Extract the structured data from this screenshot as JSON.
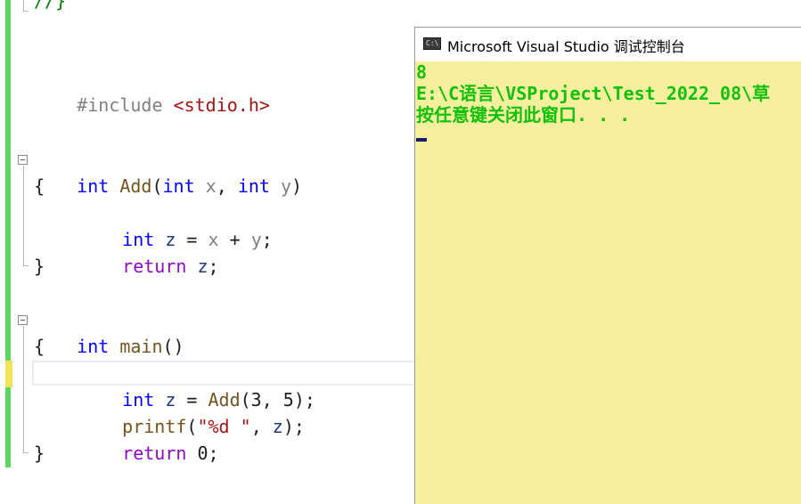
{
  "editor": {
    "top_fragment": "//}",
    "lines": {
      "include": {
        "directive": "#include",
        "header": "<stdio.h>"
      },
      "add_sig": {
        "type1": "int",
        "name": "Add",
        "open": "(",
        "type2": "int",
        "p1": "x",
        "comma": ", ",
        "type3": "int",
        "p2": "y",
        "close": ")"
      },
      "add_open": "{",
      "add_body1": {
        "type": "int",
        "var": "z",
        "eq": " = ",
        "a": "x",
        "plus": " + ",
        "b": "y",
        "semi": ";"
      },
      "add_body2": {
        "kw": "return",
        "var": "z",
        "semi": ";"
      },
      "add_close": "}",
      "main_sig": {
        "type": "int",
        "name": "main",
        "parens": "()"
      },
      "main_open": "{",
      "main_body1": {
        "type": "int",
        "var": "z",
        "eq": " = ",
        "fn": "Add",
        "args": "(3, 5);"
      },
      "main_body2": {
        "fn": "printf",
        "open": "(",
        "str": "\"%d \"",
        "comma": ", ",
        "var": "z",
        "close": ");"
      },
      "main_body3": {
        "kw": "return",
        "val": " 0;"
      },
      "main_close": "}"
    }
  },
  "console": {
    "title": "Microsoft Visual Studio 调试控制台",
    "icon_text": "C:\\",
    "output": [
      "8",
      "E:\\C语言\\VSProject\\Test_2022_08\\草",
      "按任意键关闭此窗口. . ."
    ],
    "colors": {
      "output_text": "#13c00e",
      "background": "#f5ef9e"
    }
  },
  "icons": [
    "collapse-icon",
    "console-app-icon"
  ]
}
